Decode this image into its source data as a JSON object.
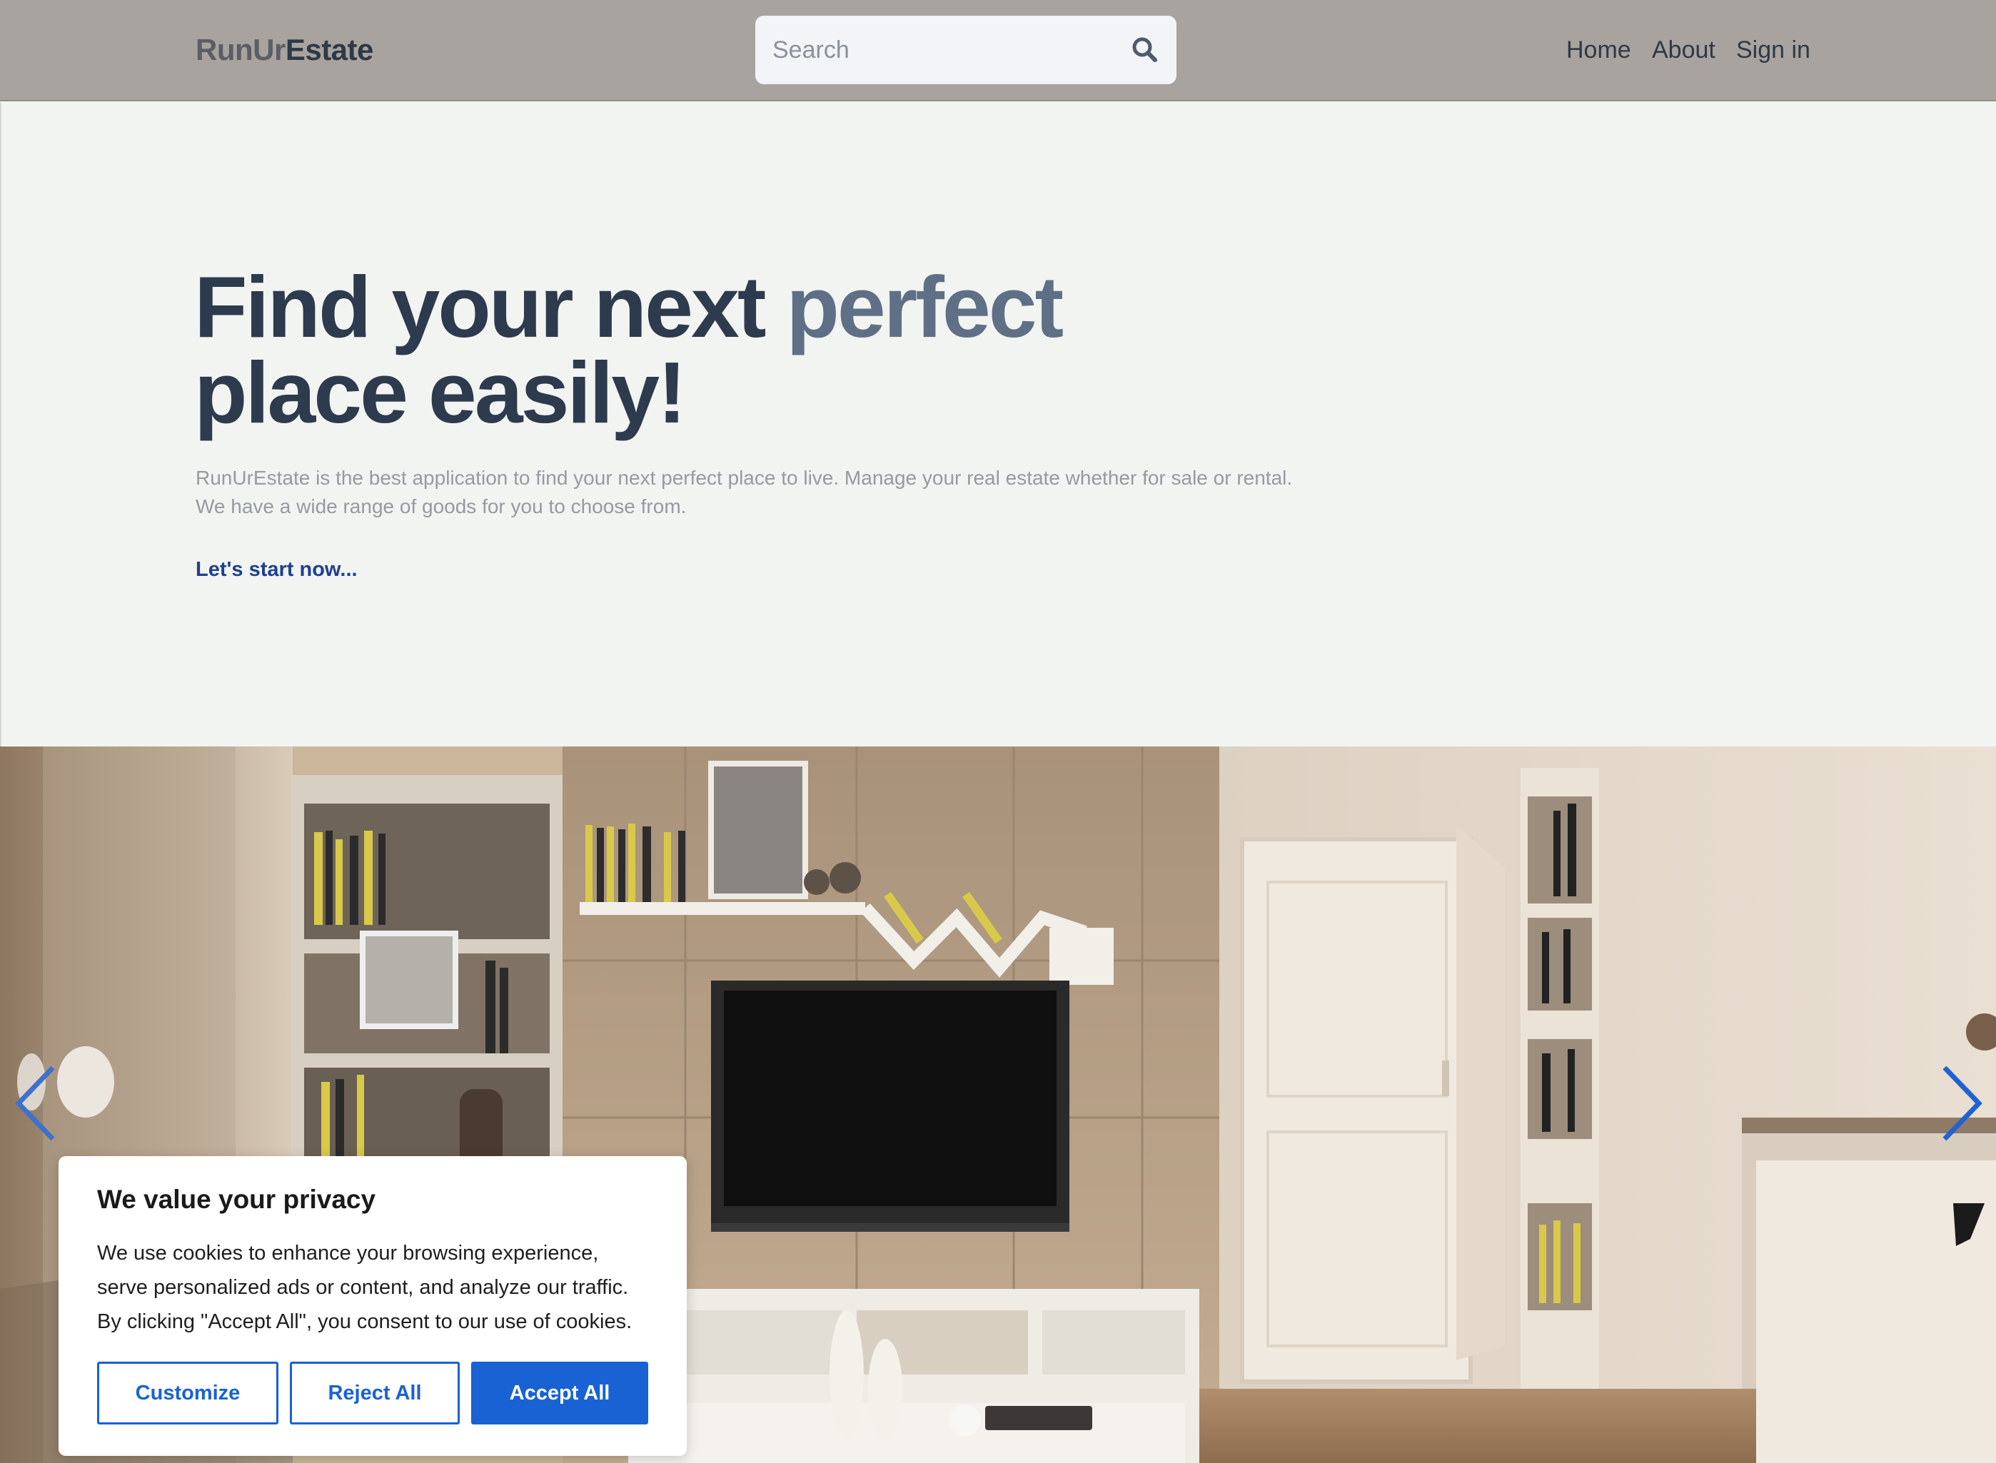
{
  "header": {
    "logo_part1": "RunUr",
    "logo_part2": "Estate",
    "search_placeholder": "Search",
    "nav": {
      "home": "Home",
      "about": "About",
      "signin": "Sign in"
    }
  },
  "hero": {
    "headline_part1": "Find your next ",
    "headline_accent": "perfect",
    "headline_part2": "place easily!",
    "description_line1": "RunUrEstate is the best application to find your next perfect place to live. Manage your real estate whether for sale or rental.",
    "description_line2": "We have a wide range of goods for you to choose from.",
    "cta": "Let's start now..."
  },
  "carousel": {
    "prev_icon": "chevron-left-icon",
    "next_icon": "chevron-right-icon"
  },
  "cookie_banner": {
    "title": "We value your privacy",
    "text_line1": "We use cookies to enhance your browsing experience,",
    "text_line2": "serve personalized ads or content, and analyze our traffic.",
    "text_line3": "By clicking \"Accept All\", you consent to our use of cookies.",
    "customize_label": "Customize",
    "reject_label": "Reject All",
    "accept_label": "Accept All"
  },
  "colors": {
    "header_bg": "#a8a39e",
    "hero_bg": "#f1f4f1",
    "headline": "#2e3a4d",
    "accent": "#5f6f86",
    "link": "#1f3f8f",
    "button_blue": "#1862d4"
  }
}
